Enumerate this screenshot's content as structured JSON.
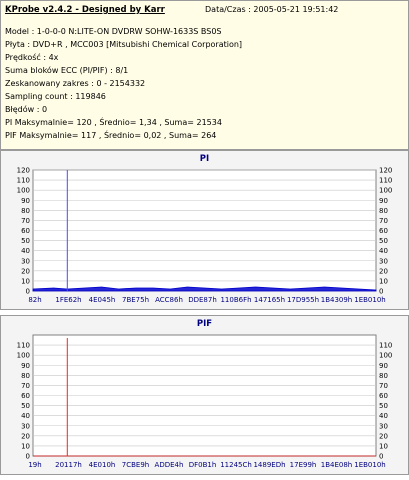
{
  "header": {
    "app_title": "KProbe v2.4.2 - Designed by Karr",
    "date_label": "Data/Czas : 2005-05-21 19:51:42"
  },
  "info": [
    "Model : 1-0-0-0 N:LITE-ON DVDRW SOHW-1633S BS0S",
    "Płyta : DVD+R , MCC003 [Mitsubishi Chemical Corporation]",
    "Prędkość : 4x",
    "Suma bloków ECC (PI/PIF) : 8/1",
    "Zeskanowany zakres : 0 - 2154332",
    "Sampling count : 119846",
    "Błędów : 0",
    "PI Maksymalnie= 120 , Średnio= 1,34 , Suma= 21534",
    "PIF Maksymalnie= 117 , Średnio= 0,02 , Suma= 264"
  ],
  "colors": {
    "pi_series": "#0000cc",
    "pi_spike": "#4a4aff",
    "pif_series": "#cc0000",
    "pif_spike": "#ff2020",
    "plot_bg": "#ffffff",
    "grid": "#c8c8c8",
    "axis_text": "#000080"
  },
  "chart_data": [
    {
      "type": "area",
      "title": "PI",
      "ylim": [
        0,
        120
      ],
      "yticks": [
        0,
        10,
        20,
        30,
        40,
        50,
        60,
        70,
        80,
        90,
        100,
        110,
        120
      ],
      "grid": true,
      "xtick_labels": [
        "82h",
        "1FE62h",
        "4E045h",
        "7BE75h",
        "ACC86h",
        "DDE87h",
        "110B6Fh",
        "147165h",
        "17D955h",
        "1B4309h",
        "1EB010h"
      ],
      "x": [
        0,
        0.06,
        0.1,
        0.15,
        0.2,
        0.25,
        0.3,
        0.35,
        0.4,
        0.45,
        0.5,
        0.55,
        0.6,
        0.65,
        0.7,
        0.75,
        0.8,
        0.85,
        0.9,
        0.95,
        1.0
      ],
      "values": [
        2,
        3,
        2,
        3,
        4,
        2,
        3,
        3,
        2,
        4,
        3,
        2,
        3,
        4,
        3,
        2,
        3,
        4,
        3,
        2,
        1
      ],
      "spikes": [
        {
          "x": 0.1,
          "value": 120
        }
      ]
    },
    {
      "type": "area",
      "title": "PIF",
      "ylim": [
        0,
        120
      ],
      "yticks": [
        0,
        10,
        20,
        30,
        40,
        50,
        60,
        70,
        80,
        90,
        100,
        110
      ],
      "grid": true,
      "xtick_labels": [
        "19h",
        "20117h",
        "4E010h",
        "7CBE9h",
        "ADDE4h",
        "DF0B1h",
        "11245Ch",
        "1489EDh",
        "17E99h",
        "1B4E08h",
        "1EB010h"
      ],
      "x": [
        0,
        0.1,
        0.2,
        0.3,
        0.4,
        0.5,
        0.6,
        0.7,
        0.8,
        0.9,
        1.0
      ],
      "values": [
        0,
        0,
        0,
        0,
        0,
        0,
        0,
        0,
        0,
        0,
        0
      ],
      "spikes": [
        {
          "x": 0.1,
          "value": 117
        }
      ]
    }
  ]
}
